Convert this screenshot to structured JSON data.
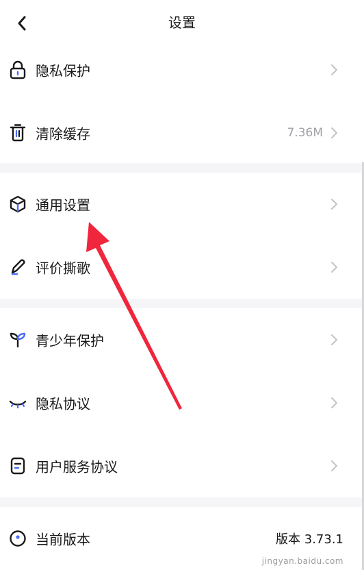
{
  "header": {
    "title": "设置"
  },
  "groups": [
    {
      "items": [
        {
          "label": "隐私保护",
          "value": ""
        },
        {
          "label": "清除缓存",
          "value": "7.36M"
        }
      ]
    },
    {
      "items": [
        {
          "label": "通用设置",
          "value": ""
        },
        {
          "label": "评价撕歌",
          "value": ""
        }
      ]
    },
    {
      "items": [
        {
          "label": "青少年保护",
          "value": ""
        },
        {
          "label": "隐私协议",
          "value": ""
        },
        {
          "label": "用户服务协议",
          "value": ""
        }
      ]
    },
    {
      "items": [
        {
          "label": "当前版本",
          "value": "版本 3.73.1"
        }
      ]
    }
  ],
  "watermark": "jingyan.baidu.com",
  "colors": {
    "accent_red": "#f0263c",
    "background": "#f5f5f7",
    "icon_blue": "#4a6cf7"
  }
}
